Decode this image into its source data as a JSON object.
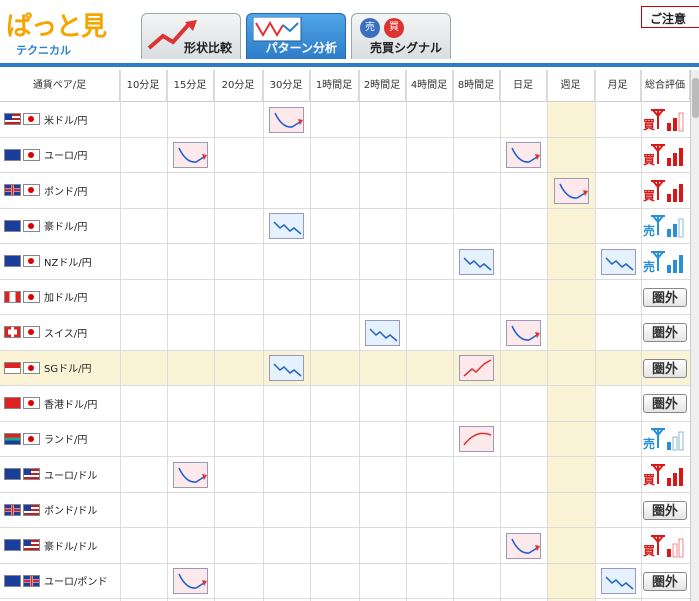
{
  "header": {
    "logo_main": "ぱっと見",
    "logo_sub": "テクニカル",
    "tabs": [
      {
        "label": "形状比較",
        "active": false
      },
      {
        "label": "パターン分析",
        "active": true
      },
      {
        "label": "売買シグナル",
        "active": false
      }
    ],
    "notice": "ご注意"
  },
  "columns": [
    "通貨ペア/足",
    "10分足",
    "15分足",
    "20分足",
    "30分足",
    "1時間足",
    "2時間足",
    "4時間足",
    "8時間足",
    "日足",
    "週足",
    "月足",
    "総合評価"
  ],
  "rows": [
    {
      "pair": "米ドル/円",
      "f1": "us",
      "f2": "jp",
      "patterns": {
        "30分足": "down-red"
      },
      "rating": "buy",
      "bars": 2
    },
    {
      "pair": "ユーロ/円",
      "f1": "eu",
      "f2": "jp",
      "patterns": {
        "15分足": "down-red",
        "日足": "down-red"
      },
      "rating": "buy",
      "bars": 3
    },
    {
      "pair": "ポンド/円",
      "f1": "gb",
      "f2": "jp",
      "patterns": {
        "週足": "down-red"
      },
      "rating": "buy",
      "bars": 3
    },
    {
      "pair": "豪ドル/円",
      "f1": "au",
      "f2": "jp",
      "patterns": {
        "30分足": "down-blue"
      },
      "rating": "sell",
      "bars": 2
    },
    {
      "pair": "NZドル/円",
      "f1": "nz",
      "f2": "jp",
      "patterns": {
        "8時間足": "down-blue",
        "月足": "down-blue"
      },
      "rating": "sell",
      "bars": 3
    },
    {
      "pair": "加ドル/円",
      "f1": "ca",
      "f2": "jp",
      "patterns": {},
      "rating": "out",
      "bars": 0
    },
    {
      "pair": "スイス/円",
      "f1": "ch",
      "f2": "jp",
      "patterns": {
        "2時間足": "down-blue",
        "日足": "down-red"
      },
      "rating": "out",
      "bars": 0
    },
    {
      "pair": "SGドル/円",
      "f1": "sg",
      "f2": "jp",
      "patterns": {
        "30分足": "down-blue",
        "8時間足": "up-red"
      },
      "rating": "out",
      "bars": 0,
      "highlight": true
    },
    {
      "pair": "香港ドル/円",
      "f1": "hk",
      "f2": "jp",
      "patterns": {},
      "rating": "out",
      "bars": 0
    },
    {
      "pair": "ランド/円",
      "f1": "za",
      "f2": "jp",
      "patterns": {
        "8時間足": "arc-red"
      },
      "rating": "sell",
      "bars": 1
    },
    {
      "pair": "ユーロ/ドル",
      "f1": "eu",
      "f2": "us",
      "patterns": {
        "15分足": "down-red"
      },
      "rating": "buy",
      "bars": 3
    },
    {
      "pair": "ポンド/ドル",
      "f1": "gb",
      "f2": "us",
      "patterns": {},
      "rating": "out",
      "bars": 0
    },
    {
      "pair": "豪ドル/ドル",
      "f1": "au",
      "f2": "us",
      "patterns": {
        "日足": "down-red"
      },
      "rating": "buy",
      "bars": 1
    },
    {
      "pair": "ユーロ/ポンド",
      "f1": "eu",
      "f2": "gb",
      "patterns": {
        "15分足": "down-red",
        "月足": "down-blue"
      },
      "rating": "out",
      "bars": 0
    }
  ],
  "rating_labels": {
    "buy": "買",
    "sell": "売",
    "out": "圏外"
  },
  "colors": {
    "buy": "#d81818",
    "sell": "#2a8fd6",
    "week_bg": "#fbf3d6",
    "accent": "#2e7cc9"
  }
}
